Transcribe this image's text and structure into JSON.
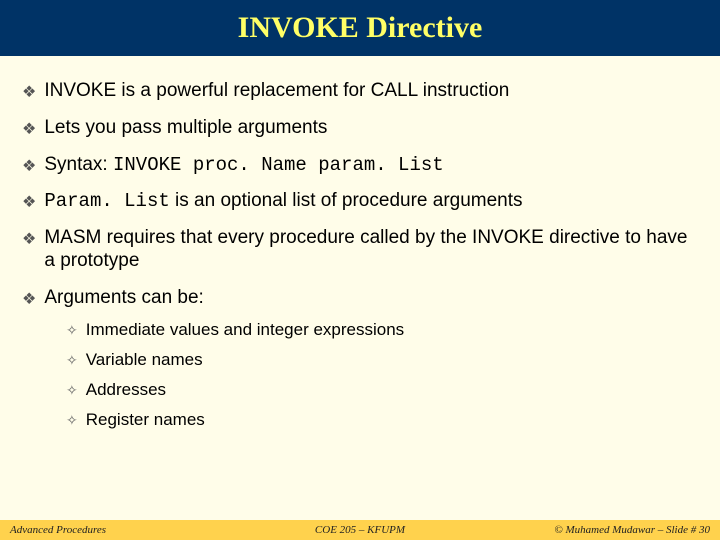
{
  "title": "INVOKE Directive",
  "bullets": {
    "b0": "INVOKE is a powerful replacement for CALL instruction",
    "b1": "Lets you pass multiple arguments",
    "b2_prefix": "Syntax: ",
    "b2_code": "INVOKE proc. Name param. List",
    "b3_code": "Param. List",
    "b3_suffix": " is an optional list of procedure arguments",
    "b4": "MASM requires that every procedure called by the INVOKE directive to have a prototype",
    "b5": "Arguments can be:"
  },
  "subs": {
    "s0": "Immediate values and integer expressions",
    "s1": "Variable names",
    "s2": "Addresses",
    "s3": "Register names"
  },
  "footer": {
    "left": "Advanced Procedures",
    "center": "COE 205 – KFUPM",
    "right": "© Muhamed Mudawar – Slide # 30"
  }
}
